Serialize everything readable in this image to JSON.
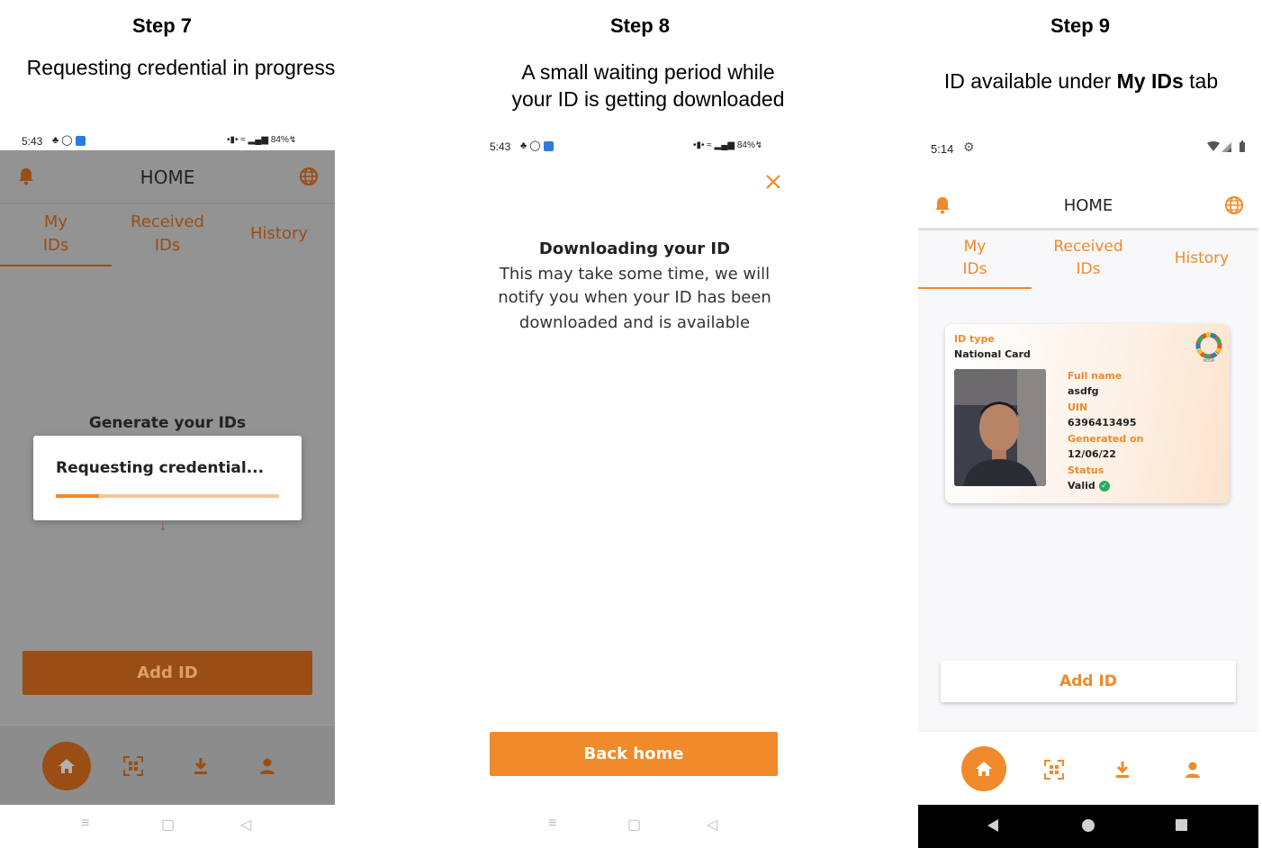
{
  "steps": [
    {
      "title": "Step 7",
      "desc_lines": [
        "Requesting credential in progress"
      ]
    },
    {
      "title": "Step 8",
      "desc_lines": [
        "A small waiting period while",
        "your ID is getting downloaded"
      ]
    },
    {
      "title": "Step 9",
      "desc_pre": "ID available under ",
      "desc_bold": "My IDs",
      "desc_post": " tab"
    }
  ],
  "screen1": {
    "time": "5:43",
    "battery": "84%",
    "header_title": "HOME",
    "tabs": [
      "My\nIDs",
      "Received\nIDs",
      "History"
    ],
    "generate_label": "Generate your IDs",
    "dialog_text": "Requesting credential...",
    "add_id_label": "Add ID"
  },
  "screen2": {
    "time": "5:43",
    "battery": "84%",
    "heading": "Downloading your ID",
    "body_lines": [
      "This may take some time, we will",
      "notify you when your ID has been",
      "downloaded and is available"
    ],
    "back_home_label": "Back home"
  },
  "screen3": {
    "time": "5:14",
    "header_title": "HOME",
    "tabs": [
      "My\nIDs",
      "Received\nIDs",
      "History"
    ],
    "card": {
      "id_type_label": "ID type",
      "id_type_value": "National Card",
      "full_name_label": "Full name",
      "full_name_value": "asdfg",
      "uin_label": "UIN",
      "uin_value": "6396413495",
      "generated_label": "Generated on",
      "generated_value": "12/06/22",
      "status_label": "Status",
      "status_value": "Valid",
      "logo_text": "MOSIP"
    },
    "add_id_label": "Add ID"
  },
  "colors": {
    "accent": "#f08a2a",
    "accent_dark": "#9a4d14",
    "overlay_gray": "#939393",
    "valid_green": "#27ae60"
  }
}
